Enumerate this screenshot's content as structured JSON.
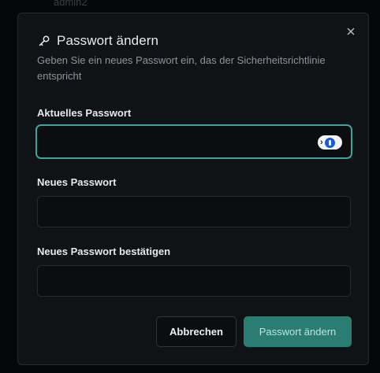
{
  "background": {
    "username": "admin2"
  },
  "dialog": {
    "title": "Passwort ändern",
    "subtitle": "Geben Sie ein neues Passwort ein, das der Sicherheitsrichtlinie entspricht",
    "close_icon": "close-icon",
    "title_icon": "key-icon",
    "fields": {
      "current": {
        "label": "Aktuelles Passwort",
        "value": "",
        "placeholder": ""
      },
      "new": {
        "label": "Neues Passwort",
        "value": "",
        "placeholder": ""
      },
      "confirm": {
        "label": "Neues Passwort bestätigen",
        "value": "",
        "placeholder": ""
      }
    },
    "password_manager_icon": "password-manager-icon",
    "buttons": {
      "cancel": "Abbrechen",
      "submit": "Passwort ändern"
    }
  },
  "colors": {
    "accent": "#3fa59a",
    "submit_bg": "#2b7d73",
    "dialog_bg": "#101316"
  }
}
